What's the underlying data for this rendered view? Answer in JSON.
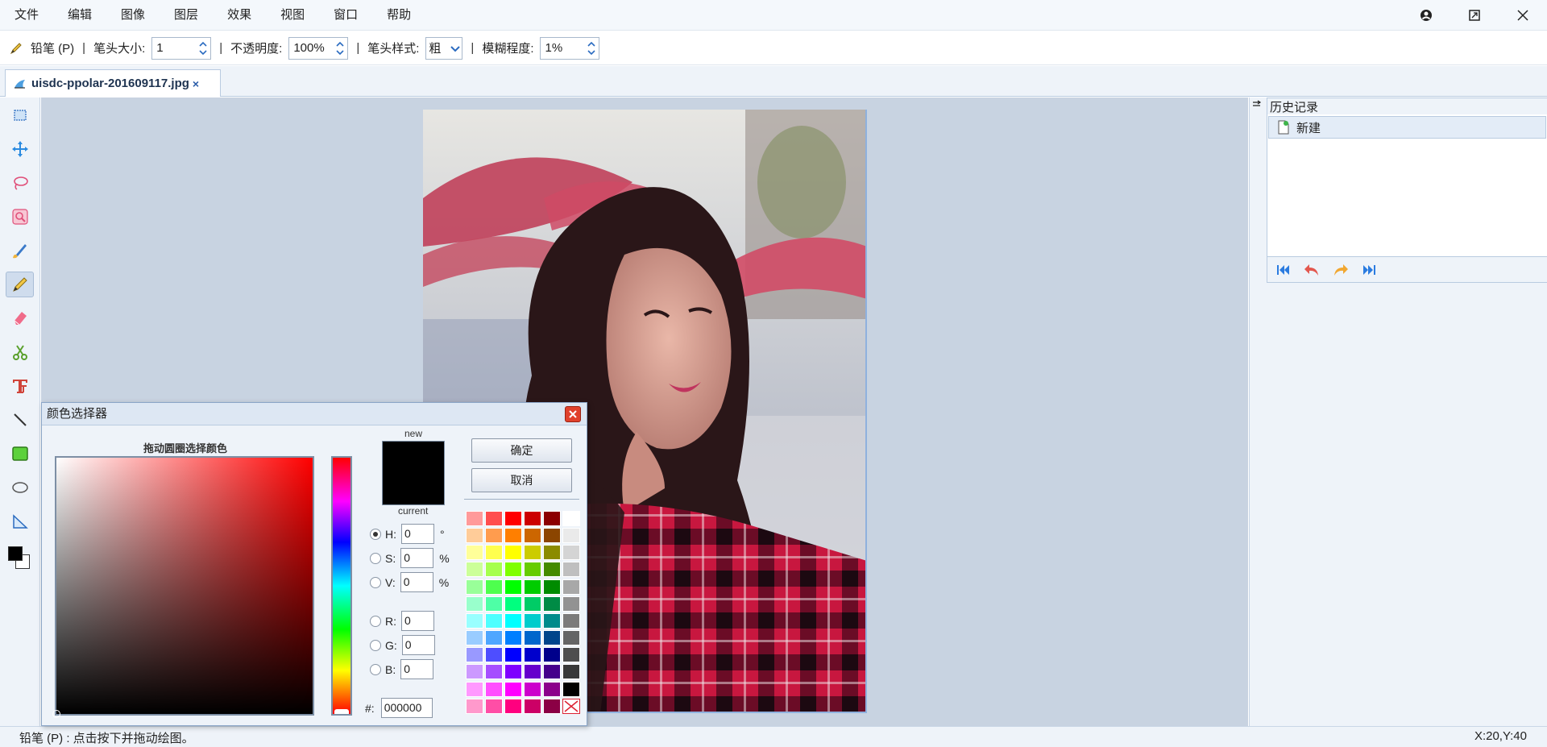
{
  "menubar": {
    "items": [
      "文件",
      "编辑",
      "图像",
      "图层",
      "效果",
      "视图",
      "窗口",
      "帮助"
    ]
  },
  "options": {
    "tool_label": "铅笔 (P)",
    "separator": "|",
    "size_label": "笔头大小:",
    "size_value": "1",
    "opacity_label": "不透明度:",
    "opacity_value": "100%",
    "style_label": "笔头样式:",
    "style_value": "粗",
    "blur_label": "模糊程度:",
    "blur_value": "1%"
  },
  "tab": {
    "filename": "uisdc-ppolar-201609117.jpg",
    "close": "×"
  },
  "history": {
    "title": "历史记录",
    "items": [
      "新建"
    ]
  },
  "status": {
    "hint": "铅笔 (P) :  点击按下并拖动绘图。",
    "coords": "X:20,Y:40"
  },
  "picker": {
    "title": "颜色选择器",
    "sv_label": "拖动圆圈选择颜色",
    "new_label": "new",
    "current_label": "current",
    "ok_label": "确定",
    "cancel_label": "取消",
    "h_label": "H:",
    "h_value": "0",
    "h_unit": "°",
    "s_label": "S:",
    "s_value": "0",
    "s_unit": "%",
    "v_label": "V:",
    "v_value": "0",
    "v_unit": "%",
    "r_label": "R:",
    "r_value": "0",
    "g_label": "G:",
    "g_value": "0",
    "b_label": "B:",
    "b_value": "0",
    "hex_label": "#:",
    "hex_value": "000000",
    "current_color": "#000000",
    "palette": [
      "#ff9a9a",
      "#ff4e4e",
      "#ff0000",
      "#cc0000",
      "#8b0000",
      "#ffffff",
      "#ffcc99",
      "#ff9c4e",
      "#ff7f00",
      "#cc6600",
      "#8b4500",
      "#eaeaea",
      "#ffff99",
      "#ffff4e",
      "#ffff00",
      "#cccc00",
      "#8b8b00",
      "#d4d4d4",
      "#ccff99",
      "#a6ff4e",
      "#7fff00",
      "#66cc00",
      "#458b00",
      "#bfbfbf",
      "#99ff99",
      "#4eff4e",
      "#00ff00",
      "#00cc00",
      "#008b00",
      "#a8a8a8",
      "#99ffcc",
      "#4effa6",
      "#00ff7f",
      "#00cc66",
      "#008b45",
      "#929292",
      "#99ffff",
      "#4effff",
      "#00ffff",
      "#00cccc",
      "#008b8b",
      "#7b7b7b",
      "#99ccff",
      "#4ea6ff",
      "#007fff",
      "#0066cc",
      "#00458b",
      "#656565",
      "#9999ff",
      "#4e4eff",
      "#0000ff",
      "#0000cc",
      "#00008b",
      "#4e4e4e",
      "#cc99ff",
      "#a64eff",
      "#7f00ff",
      "#6600cc",
      "#45008b",
      "#383838",
      "#ff99ff",
      "#ff4eff",
      "#ff00ff",
      "#cc00cc",
      "#8b008b",
      "#000000",
      "#ff99cc",
      "#ff4ea6",
      "#ff007f",
      "#cc0066",
      "#8b0045",
      "transparent"
    ]
  },
  "colors": {
    "foreground": "#000000",
    "background": "#ffffff"
  },
  "tools": [
    "select-rect-icon",
    "move-icon",
    "lasso-icon",
    "magic-wand-icon",
    "brush-icon",
    "pencil-icon",
    "eraser-icon",
    "scissors-icon",
    "text-icon",
    "line-icon",
    "rectangle-icon",
    "ellipse-icon",
    "triangle-icon"
  ]
}
